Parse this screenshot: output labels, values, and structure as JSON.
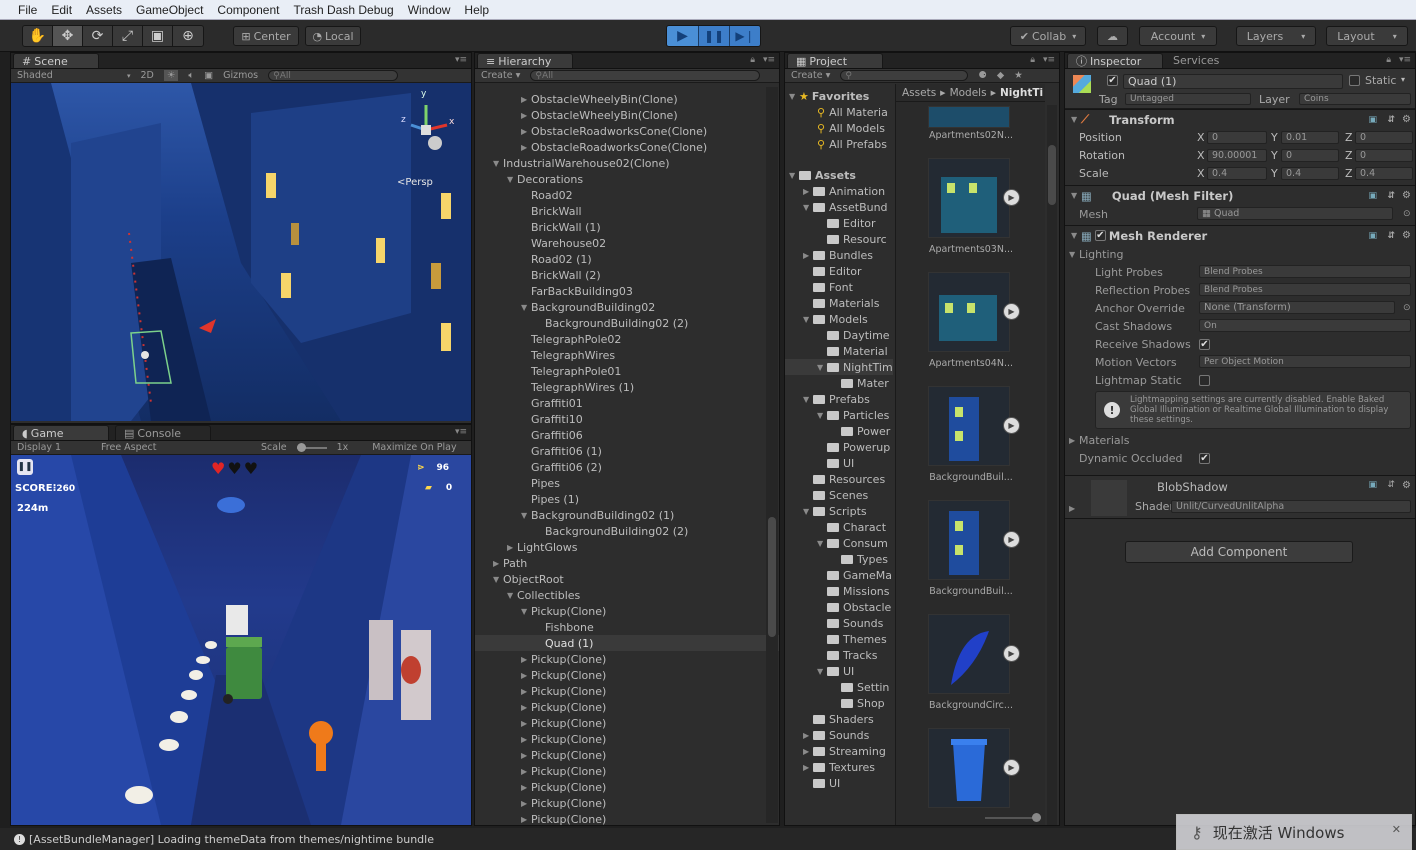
{
  "menu": [
    "File",
    "Edit",
    "Assets",
    "GameObject",
    "Component",
    "Trash Dash Debug",
    "Window",
    "Help"
  ],
  "toolbar": {
    "center": "Center",
    "local": "Local",
    "collab": "Collab",
    "account": "Account",
    "layers": "Layers",
    "layout": "Layout"
  },
  "scene": {
    "tab": "Scene",
    "shaded": "Shaded",
    "mode2d": "2D",
    "gizmos": "Gizmos",
    "search": "All",
    "persp": "Persp",
    "axis_x": "x",
    "axis_y": "y",
    "axis_z": "z"
  },
  "game": {
    "tab": "Game",
    "console_tab": "Console",
    "display": "Display 1",
    "aspect": "Free Aspect",
    "scale_label": "Scale",
    "scale_value": "1x",
    "maximize": "Maximize On Play",
    "score_label": "SCORE",
    "score": "260",
    "distance": "224m",
    "fish_count": "96",
    "premium_count": "0"
  },
  "hierarchy": {
    "tab": "Hierarchy",
    "create": "Create",
    "search": "All",
    "rows": [
      {
        "d": 3,
        "t": "▶",
        "l": "ObstacleWheelyBin(Clone)"
      },
      {
        "d": 3,
        "t": "▶",
        "l": "ObstacleWheelyBin(Clone)"
      },
      {
        "d": 3,
        "t": "▶",
        "l": "ObstacleRoadworksCone(Clone)"
      },
      {
        "d": 3,
        "t": "▶",
        "l": "ObstacleRoadworksCone(Clone)"
      },
      {
        "d": 1,
        "t": "▼",
        "l": "IndustrialWarehouse02(Clone)"
      },
      {
        "d": 2,
        "t": "▼",
        "l": "Decorations"
      },
      {
        "d": 3,
        "t": "",
        "l": "Road02"
      },
      {
        "d": 3,
        "t": "",
        "l": "BrickWall"
      },
      {
        "d": 3,
        "t": "",
        "l": "BrickWall (1)"
      },
      {
        "d": 3,
        "t": "",
        "l": "Warehouse02"
      },
      {
        "d": 3,
        "t": "",
        "l": "Road02 (1)"
      },
      {
        "d": 3,
        "t": "",
        "l": "BrickWall (2)"
      },
      {
        "d": 3,
        "t": "",
        "l": "FarBackBuilding03"
      },
      {
        "d": 3,
        "t": "▼",
        "l": "BackgroundBuilding02"
      },
      {
        "d": 4,
        "t": "",
        "l": "BackgroundBuilding02 (2)"
      },
      {
        "d": 3,
        "t": "",
        "l": "TelegraphPole02"
      },
      {
        "d": 3,
        "t": "",
        "l": "TelegraphWires"
      },
      {
        "d": 3,
        "t": "",
        "l": "TelegraphPole01"
      },
      {
        "d": 3,
        "t": "",
        "l": "TelegraphWires (1)"
      },
      {
        "d": 3,
        "t": "",
        "l": "Graffiti01"
      },
      {
        "d": 3,
        "t": "",
        "l": "Graffiti10"
      },
      {
        "d": 3,
        "t": "",
        "l": "Graffiti06"
      },
      {
        "d": 3,
        "t": "",
        "l": "Graffiti06 (1)"
      },
      {
        "d": 3,
        "t": "",
        "l": "Graffiti06 (2)"
      },
      {
        "d": 3,
        "t": "",
        "l": "Pipes"
      },
      {
        "d": 3,
        "t": "",
        "l": "Pipes (1)"
      },
      {
        "d": 3,
        "t": "▼",
        "l": "BackgroundBuilding02 (1)"
      },
      {
        "d": 4,
        "t": "",
        "l": "BackgroundBuilding02 (2)"
      },
      {
        "d": 2,
        "t": "▶",
        "l": "LightGlows"
      },
      {
        "d": 1,
        "t": "▶",
        "l": "Path"
      },
      {
        "d": 1,
        "t": "▼",
        "l": "ObjectRoot"
      },
      {
        "d": 2,
        "t": "▼",
        "l": "Collectibles"
      },
      {
        "d": 3,
        "t": "▼",
        "l": "Pickup(Clone)"
      },
      {
        "d": 4,
        "t": "",
        "l": "Fishbone"
      },
      {
        "d": 4,
        "t": "",
        "l": "Quad (1)",
        "sel": true
      },
      {
        "d": 3,
        "t": "▶",
        "l": "Pickup(Clone)"
      },
      {
        "d": 3,
        "t": "▶",
        "l": "Pickup(Clone)"
      },
      {
        "d": 3,
        "t": "▶",
        "l": "Pickup(Clone)"
      },
      {
        "d": 3,
        "t": "▶",
        "l": "Pickup(Clone)"
      },
      {
        "d": 3,
        "t": "▶",
        "l": "Pickup(Clone)"
      },
      {
        "d": 3,
        "t": "▶",
        "l": "Pickup(Clone)"
      },
      {
        "d": 3,
        "t": "▶",
        "l": "Pickup(Clone)"
      },
      {
        "d": 3,
        "t": "▶",
        "l": "Pickup(Clone)"
      },
      {
        "d": 3,
        "t": "▶",
        "l": "Pickup(Clone)"
      },
      {
        "d": 3,
        "t": "▶",
        "l": "Pickup(Clone)"
      },
      {
        "d": 3,
        "t": "▶",
        "l": "Pickup(Clone)"
      }
    ]
  },
  "project": {
    "tab": "Project",
    "create": "Create",
    "breadcrumb": [
      "Assets",
      "Models",
      "NightTi"
    ],
    "favorites_label": "Favorites",
    "favorites": [
      "All Materia",
      "All Models",
      "All Prefabs"
    ],
    "assets_label": "Assets",
    "tree": [
      {
        "d": 1,
        "t": "▶",
        "l": "Animation"
      },
      {
        "d": 1,
        "t": "▼",
        "l": "AssetBund"
      },
      {
        "d": 2,
        "t": "",
        "l": "Editor"
      },
      {
        "d": 2,
        "t": "",
        "l": "Resourc"
      },
      {
        "d": 1,
        "t": "▶",
        "l": "Bundles"
      },
      {
        "d": 1,
        "t": "",
        "l": "Editor"
      },
      {
        "d": 1,
        "t": "",
        "l": "Font"
      },
      {
        "d": 1,
        "t": "",
        "l": "Materials"
      },
      {
        "d": 1,
        "t": "▼",
        "l": "Models"
      },
      {
        "d": 2,
        "t": "",
        "l": "Daytime"
      },
      {
        "d": 2,
        "t": "",
        "l": "Material"
      },
      {
        "d": 2,
        "t": "▼",
        "l": "NightTim",
        "sel": true
      },
      {
        "d": 3,
        "t": "",
        "l": "Mater"
      },
      {
        "d": 1,
        "t": "▼",
        "l": "Prefabs"
      },
      {
        "d": 2,
        "t": "▼",
        "l": "Particles"
      },
      {
        "d": 3,
        "t": "",
        "l": "Power"
      },
      {
        "d": 2,
        "t": "",
        "l": "Powerup"
      },
      {
        "d": 2,
        "t": "",
        "l": "UI"
      },
      {
        "d": 1,
        "t": "",
        "l": "Resources"
      },
      {
        "d": 1,
        "t": "",
        "l": "Scenes"
      },
      {
        "d": 1,
        "t": "▼",
        "l": "Scripts"
      },
      {
        "d": 2,
        "t": "",
        "l": "Charact"
      },
      {
        "d": 2,
        "t": "▼",
        "l": "Consum"
      },
      {
        "d": 3,
        "t": "",
        "l": "Types"
      },
      {
        "d": 2,
        "t": "",
        "l": "GameMa"
      },
      {
        "d": 2,
        "t": "",
        "l": "Missions"
      },
      {
        "d": 2,
        "t": "",
        "l": "Obstacle"
      },
      {
        "d": 2,
        "t": "",
        "l": "Sounds"
      },
      {
        "d": 2,
        "t": "",
        "l": "Themes"
      },
      {
        "d": 2,
        "t": "",
        "l": "Tracks"
      },
      {
        "d": 2,
        "t": "▼",
        "l": "UI"
      },
      {
        "d": 3,
        "t": "",
        "l": "Settin"
      },
      {
        "d": 3,
        "t": "",
        "l": "Shop"
      },
      {
        "d": 1,
        "t": "",
        "l": "Shaders"
      },
      {
        "d": 1,
        "t": "▶",
        "l": "Sounds"
      },
      {
        "d": 1,
        "t": "▶",
        "l": "Streaming"
      },
      {
        "d": 1,
        "t": "▶",
        "l": "Textures"
      },
      {
        "d": 1,
        "t": "",
        "l": "UI"
      }
    ],
    "assets_grid": [
      "Apartments02N...",
      "Apartments03N...",
      "Apartments04N...",
      "BackgroundBuil...",
      "BackgroundBuil...",
      "BackgroundCirc..."
    ]
  },
  "inspector": {
    "tab": "Inspector",
    "services_tab": "Services",
    "object_name": "Quad (1)",
    "static_label": "Static",
    "tag_label": "Tag",
    "tag_value": "Untagged",
    "layer_label": "Layer",
    "layer_value": "Coins",
    "transform": {
      "title": "Transform",
      "position_label": "Position",
      "rotation_label": "Rotation",
      "scale_label": "Scale",
      "px": "0",
      "py": "0.01",
      "pz": "0",
      "rx": "90.00001",
      "ry": "0",
      "rz": "0",
      "sx": "0.4",
      "sy": "0.4",
      "sz": "0.4"
    },
    "mesh_filter": {
      "title": "Quad (Mesh Filter)",
      "mesh_label": "Mesh",
      "mesh_value": "Quad"
    },
    "mesh_renderer": {
      "title": "Mesh Renderer",
      "lighting": "Lighting",
      "light_probes_label": "Light Probes",
      "light_probes": "Blend Probes",
      "reflection_probes_label": "Reflection Probes",
      "reflection_probes": "Blend Probes",
      "anchor_label": "Anchor Override",
      "anchor": "None (Transform)",
      "cast_label": "Cast Shadows",
      "cast": "On",
      "receive_label": "Receive Shadows",
      "motion_label": "Motion Vectors",
      "motion": "Per Object Motion",
      "lightmap_label": "Lightmap Static",
      "info": "Lightmapping settings are currently disabled. Enable Baked Global Illumination or Realtime Global Illumination to display these settings.",
      "materials": "Materials",
      "dynamic_label": "Dynamic Occluded"
    },
    "material": {
      "name": "BlobShadow",
      "shader_label": "Shader",
      "shader": "Unlit/CurvedUnlitAlpha"
    },
    "add_component": "Add Component"
  },
  "status": {
    "message": "[AssetBundleManager] Loading themeData from themes/nightime bundle"
  },
  "watermark": "现在激活 Windows",
  "colors": {
    "accent_play": "#4a8fd6",
    "selection": "#3a3a3a",
    "panel_bg": "#2d2d2d"
  }
}
